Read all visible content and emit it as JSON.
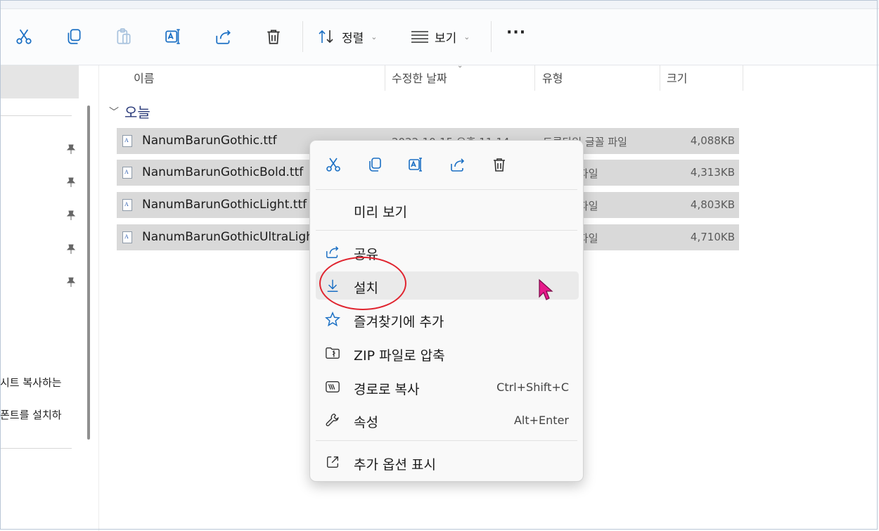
{
  "toolbar": {
    "sort_label": "정렬",
    "view_label": "보기",
    "more_label": "···",
    "icons": [
      "cut-icon",
      "copy-icon",
      "paste-icon",
      "rename-icon",
      "share-icon",
      "delete-icon",
      "sort-icon",
      "view-icon"
    ]
  },
  "sidebar": {
    "snippets": [
      "시트 복사하는",
      "폰트를 설치하"
    ]
  },
  "columns": [
    "이름",
    "수정한 날짜",
    "유형",
    "크기"
  ],
  "group": {
    "label": "오늘"
  },
  "files": [
    {
      "name": "NanumBarunGothic.ttf",
      "date": "2022-10-15 오후 11:14",
      "type": "트루타입 글꼴 파일",
      "size": "4,088KB"
    },
    {
      "name": "NanumBarunGothicBold.ttf",
      "date": "",
      "type": "입 글꼴 파일",
      "size": "4,313KB"
    },
    {
      "name": "NanumBarunGothicLight.ttf",
      "date": "",
      "type": "입 글꼴 파일",
      "size": "4,803KB"
    },
    {
      "name": "NanumBarunGothicUltraLight.",
      "date": "",
      "type": "입 글꼴 파일",
      "size": "4,710KB"
    }
  ],
  "context_menu": {
    "top_icons": [
      "cut-icon",
      "copy-icon",
      "rename-icon",
      "share-icon",
      "delete-icon"
    ],
    "preview": "미리 보기",
    "share": "공유",
    "install": "설치",
    "favorite": "즐겨찾기에 추가",
    "zip": "ZIP 파일로 압축",
    "copy_path": "경로로 복사",
    "copy_path_shortcut": "Ctrl+Shift+C",
    "properties": "속성",
    "properties_shortcut": "Alt+Enter",
    "more_options": "추가 옵션 표시"
  },
  "colors": {
    "accent": "#1a73c8",
    "highlight_circle": "#e0242f",
    "cursor": "#e6198a",
    "selection": "#d9d9d9"
  }
}
